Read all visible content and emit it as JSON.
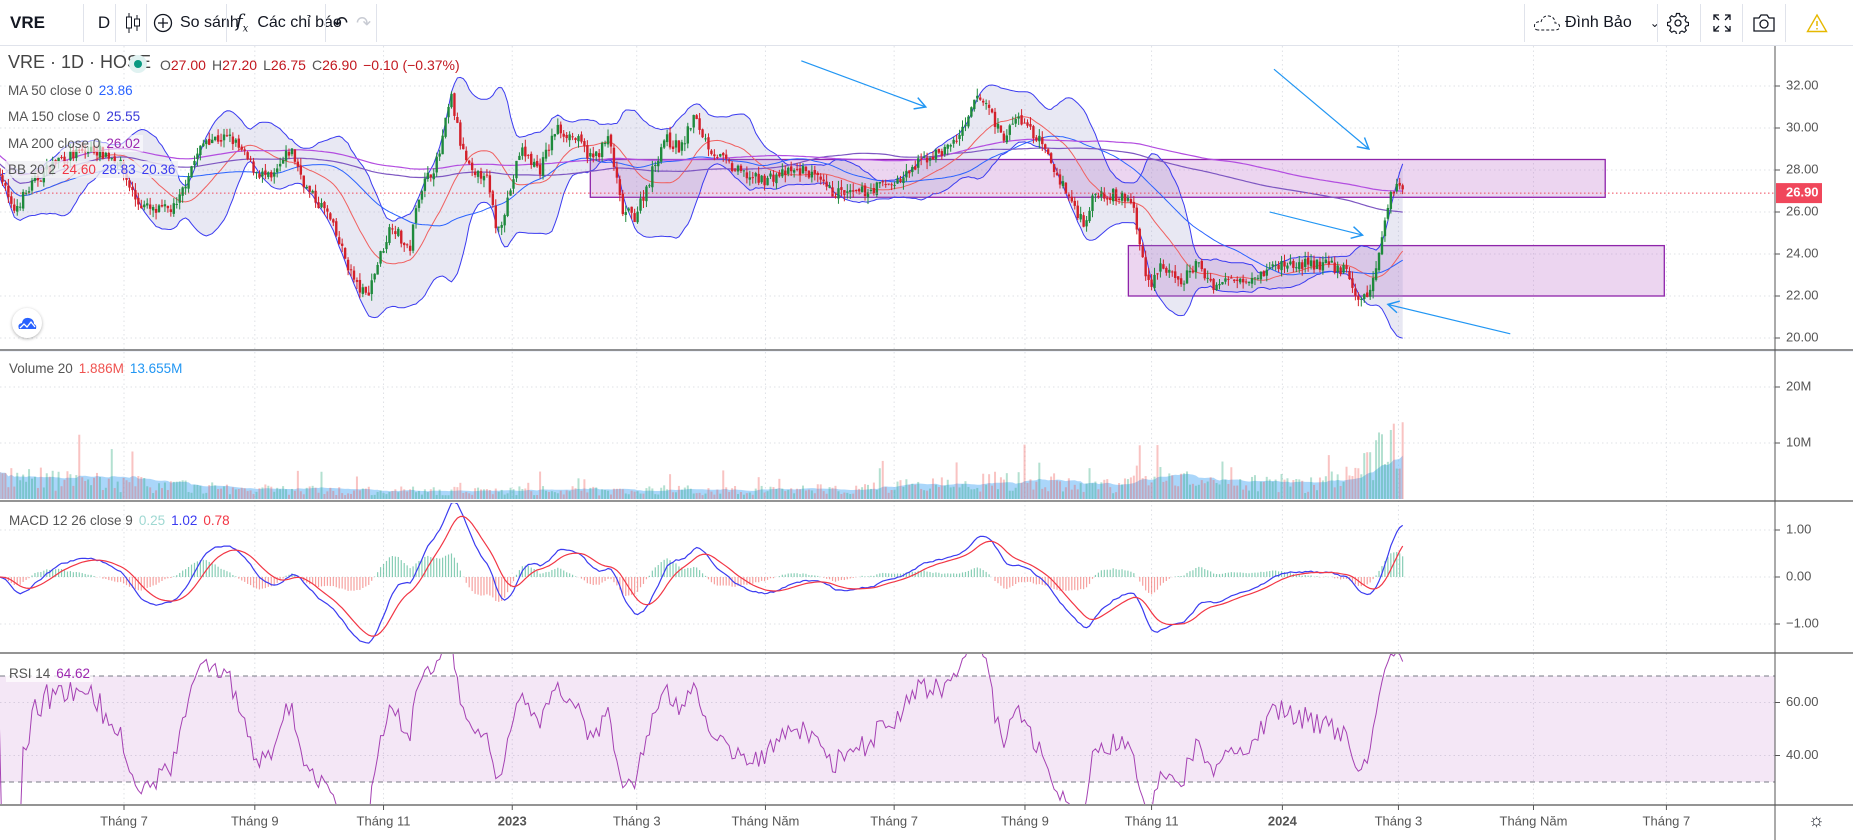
{
  "toolbar": {
    "symbol": "VRE",
    "interval": "D",
    "compare_label": "So sánh",
    "indicators_label": "Các chỉ báo",
    "user_label": "Đình Bảo"
  },
  "legend": {
    "title": "VRE · 1D · HOSE",
    "ohlc": {
      "o_label": "O",
      "o": "27.00",
      "h_label": "H",
      "h": "27.20",
      "l_label": "L",
      "l": "26.75",
      "c_label": "C",
      "c": "26.90",
      "change": "−0.10 (−0.37%)"
    },
    "ma50": {
      "label": "MA 50 close 0",
      "value": "23.86"
    },
    "ma150": {
      "label": "MA 150 close 0",
      "value": "25.55"
    },
    "ma200": {
      "label": "MA 200 close 0",
      "value": "26.02"
    },
    "bb": {
      "label": "BB 20 2",
      "basis": "24.60",
      "upper": "28.83",
      "lower": "20.36"
    },
    "volume": {
      "label": "Volume 20",
      "value": "1.886M",
      "ma": "13.655M"
    },
    "macd": {
      "label": "MACD 12 26 close 9",
      "hist": "0.25",
      "macd": "1.02",
      "signal": "0.78"
    },
    "rsi": {
      "label": "RSI 14",
      "value": "64.62"
    }
  },
  "colors": {
    "up": "#1e8a3c",
    "down": "#d3202a",
    "ma50": "#2962ff",
    "ma150": "#7e57c2",
    "ma200": "#b34de0",
    "bb": "#3b3bf0",
    "bb_fill": "#c9c9e6",
    "box": "#8e24aa",
    "arrow": "#2196f3",
    "volume_ma": "#64b5f6",
    "macd": "#3b3bf0",
    "signal": "#f23645",
    "rsi": "#a541b3",
    "last_price": "#f0475b"
  },
  "chart_data": {
    "type": "candlestick",
    "x_unit": "days since 2022-07-01",
    "price_path": [
      [
        -59,
        28.0
      ],
      [
        -53,
        26.0
      ],
      [
        -42,
        27.5
      ],
      [
        -31,
        28.5
      ],
      [
        -14,
        29.0
      ],
      [
        -3,
        28.5
      ],
      [
        6,
        26.5
      ],
      [
        14,
        26.0
      ],
      [
        25,
        26.2
      ],
      [
        31,
        28.0
      ],
      [
        39,
        29.5
      ],
      [
        51,
        29.5
      ],
      [
        62,
        28.0
      ],
      [
        70,
        27.5
      ],
      [
        79,
        29.0
      ],
      [
        87,
        27.0
      ],
      [
        96,
        26.0
      ],
      [
        104,
        24.0
      ],
      [
        110,
        22.5
      ],
      [
        115,
        22.0
      ],
      [
        120,
        23.5
      ],
      [
        127,
        25.5
      ],
      [
        135,
        24.0
      ],
      [
        140,
        27.0
      ],
      [
        149,
        28.5
      ],
      [
        155,
        31.5
      ],
      [
        160,
        29.0
      ],
      [
        166,
        27.5
      ],
      [
        171,
        28.0
      ],
      [
        177,
        25.0
      ],
      [
        183,
        27.0
      ],
      [
        188,
        29.0
      ],
      [
        197,
        28.0
      ],
      [
        205,
        30.0
      ],
      [
        214,
        29.5
      ],
      [
        222,
        28.5
      ],
      [
        230,
        29.5
      ],
      [
        236,
        26.0
      ],
      [
        242,
        25.8
      ],
      [
        247,
        27.0
      ],
      [
        256,
        29.5
      ],
      [
        264,
        29.0
      ],
      [
        270,
        30.5
      ],
      [
        278,
        29.0
      ],
      [
        289,
        28.0
      ],
      [
        301,
        27.5
      ],
      [
        312,
        27.8
      ],
      [
        323,
        28.0
      ],
      [
        334,
        27.0
      ],
      [
        346,
        26.8
      ],
      [
        357,
        27.2
      ],
      [
        368,
        27.5
      ],
      [
        379,
        28.5
      ],
      [
        390,
        29.0
      ],
      [
        399,
        30.0
      ],
      [
        404,
        31.5
      ],
      [
        410,
        31.0
      ],
      [
        416,
        29.5
      ],
      [
        424,
        30.5
      ],
      [
        433,
        29.5
      ],
      [
        441,
        28.0
      ],
      [
        449,
        26.5
      ],
      [
        455,
        25.5
      ],
      [
        461,
        27.0
      ],
      [
        469,
        26.8
      ],
      [
        478,
        26.5
      ],
      [
        481,
        24.5
      ],
      [
        486,
        22.5
      ],
      [
        491,
        23.5
      ],
      [
        500,
        22.5
      ],
      [
        508,
        23.5
      ],
      [
        517,
        22.5
      ],
      [
        525,
        22.8
      ],
      [
        536,
        23.0
      ],
      [
        548,
        23.5
      ],
      [
        559,
        23.5
      ],
      [
        570,
        23.5
      ],
      [
        579,
        23.2
      ],
      [
        584,
        22.0
      ],
      [
        588,
        21.8
      ],
      [
        593,
        23.0
      ],
      [
        597,
        25.5
      ],
      [
        601,
        27.0
      ],
      [
        604,
        27.5
      ],
      [
        607,
        26.9
      ]
    ],
    "volume_profile_millions": [
      [
        -59,
        4
      ],
      [
        -20,
        3.5
      ],
      [
        40,
        2
      ],
      [
        100,
        1.5
      ],
      [
        300,
        1.6
      ],
      [
        380,
        2.5
      ],
      [
        420,
        3.5
      ],
      [
        470,
        2.5
      ],
      [
        490,
        3.5
      ],
      [
        560,
        2.5
      ],
      [
        580,
        4
      ],
      [
        595,
        9
      ],
      [
        607,
        13.6
      ]
    ],
    "last_price": 26.9,
    "price_axis": {
      "ticks": [
        "32.00",
        "30.00",
        "28.00",
        "26.00",
        "24.00",
        "22.00",
        "20.00"
      ],
      "range": [
        19.5,
        34.5
      ]
    },
    "volume_axis": {
      "ticks": [
        "20M",
        "10M"
      ]
    },
    "macd_axis": {
      "ticks": [
        "1.00",
        "0.00",
        "−1.00"
      ]
    },
    "rsi_axis": {
      "ticks": [
        "60.00",
        "40.00"
      ],
      "bands": [
        30,
        70
      ]
    },
    "time_axis": [
      {
        "label": "Tháng 7",
        "day": 0
      },
      {
        "label": "Tháng 9",
        "day": 62
      },
      {
        "label": "Tháng 11",
        "day": 123
      },
      {
        "label": "2023",
        "day": 184
      },
      {
        "label": "Tháng 3",
        "day": 243
      },
      {
        "label": "Tháng Năm",
        "day": 304
      },
      {
        "label": "Tháng 7",
        "day": 365
      },
      {
        "label": "Tháng 9",
        "day": 427
      },
      {
        "label": "Tháng 11",
        "day": 487
      },
      {
        "label": "2024",
        "day": 549
      },
      {
        "label": "Tháng 3",
        "day": 604
      },
      {
        "label": "Tháng Năm",
        "day": 668
      },
      {
        "label": "Tháng 7",
        "day": 731
      }
    ],
    "zones": [
      {
        "day_from": 221,
        "day_to": 702,
        "price_from": 26.7,
        "price_to": 28.5
      },
      {
        "day_from": 476,
        "day_to": 730,
        "price_from": 22.0,
        "price_to": 24.4
      }
    ],
    "arrows": [
      {
        "from": [
          321,
          33.2
        ],
        "to": [
          380,
          31.0
        ]
      },
      {
        "from": [
          545,
          32.8
        ],
        "to": [
          590,
          29.0
        ]
      },
      {
        "from": [
          543,
          26.0
        ],
        "to": [
          587,
          24.9
        ]
      },
      {
        "from": [
          657,
          20.2
        ],
        "to": [
          599,
          21.6
        ]
      }
    ]
  }
}
